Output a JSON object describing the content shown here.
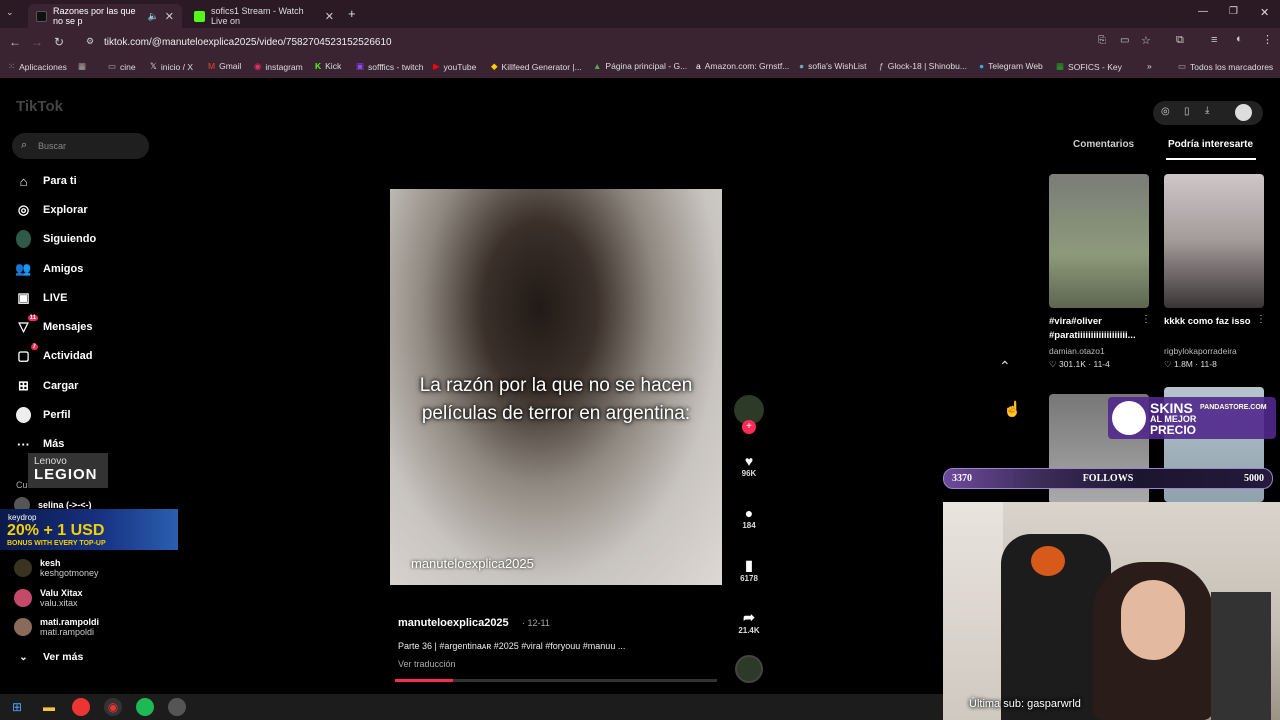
{
  "browser": {
    "tabs": [
      {
        "title": "Razones por las que no se p",
        "active": true
      },
      {
        "title": "sofics1 Stream - Watch Live on",
        "active": false
      }
    ],
    "url": "tiktok.com/@manuteloexplica2025/video/7582704523152526610",
    "bookmarks": [
      "Aplicaciones",
      "cine",
      "inicio / X",
      "Gmail",
      "instagram",
      "Kick",
      "sofffics - twitch",
      "youTube",
      "Killfeed Generator |...",
      "Página principal - G...",
      "Amazon.com: Grnstf...",
      "sofia's WishList",
      "Glock-18 | Shinobu...",
      "Telegram Web",
      "SOFICS - Key"
    ],
    "all_bookmarks": "Todos los marcadores"
  },
  "tiktok": {
    "logo": "TikTok",
    "search_placeholder": "Buscar",
    "nav": [
      {
        "label": "Para ti",
        "icon": "home-icon"
      },
      {
        "label": "Explorar",
        "icon": "compass-icon"
      },
      {
        "label": "Siguiendo",
        "icon": "following-avatar-icon"
      },
      {
        "label": "Amigos",
        "icon": "friends-icon"
      },
      {
        "label": "LIVE",
        "icon": "live-icon"
      },
      {
        "label": "Mensajes",
        "icon": "messages-icon",
        "badge": "11"
      },
      {
        "label": "Actividad",
        "icon": "activity-icon",
        "badge": "7"
      },
      {
        "label": "Cargar",
        "icon": "upload-icon"
      },
      {
        "label": "Perfil",
        "icon": "profile-icon"
      },
      {
        "label": "Más",
        "icon": "more-icon"
      }
    ],
    "following_header": "Cu",
    "following": [
      {
        "name": "selina (->-<-)",
        "handle": ""
      },
      {
        "name": "kesh",
        "handle": "keshgotmoney"
      },
      {
        "name": "Valu Xitax",
        "handle": "valu.xitax"
      },
      {
        "name": "mati.rampoldi",
        "handle": "mati.rampoldi"
      }
    ],
    "see_more": "Ver más",
    "video": {
      "caption": "La razón por la que no se hacen películas de terror en argentina:",
      "watermark": "manuteloexplica2025",
      "author": "manuteloexplica2025",
      "date": "· 12-11",
      "description": "Parte 36 | #argentinaᴀʀ #2025 #viral #foryouu #manuu ...",
      "translate": "Ver traducción",
      "likes": "96K",
      "comments": "184",
      "saves": "6178",
      "shares": "21.4K",
      "progress": 0.18
    },
    "side_tabs": {
      "comments": "Comentarios",
      "suggested": "Podría interesarte"
    },
    "suggested": [
      {
        "title": "#vira#oliver #paratiiiiiiiiiiiiiiiiiii...",
        "author": "damian.otazo1",
        "stats": "♡ 301.1K · 11-4"
      },
      {
        "title": "kkkk como faz isso",
        "author": "rigbylokaporradeira",
        "stats": "♡ 1.8M · 11-8"
      }
    ]
  },
  "stream": {
    "lenovo_top": "Lenovo",
    "lenovo_bottom": "LEGION",
    "keydrop": "keydrop",
    "promo_big": "20% + 1 USD",
    "promo_small": "BONUS WITH EVERY TOP-UP",
    "skins_line1": "SKINS",
    "skins_line2": "AL MEJOR",
    "skins_line3": "PRECIO",
    "skins_site": "PANDASTORE.COM",
    "follows_current": "3370",
    "follows_label": "FOLLOWS",
    "follows_goal": "5000",
    "last_sub": "Última sub: gasparwrld"
  }
}
